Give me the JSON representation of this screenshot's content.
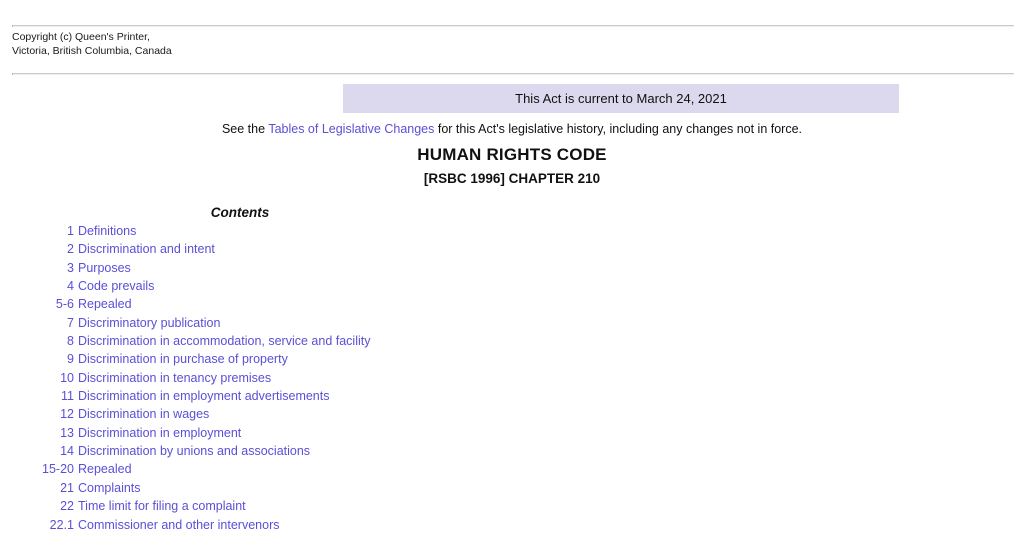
{
  "header": {
    "copyright": "Copyright (c) Queen's Printer,\nVictoria, British Columbia, Canada"
  },
  "banner": {
    "currency_notice": "This Act is current to March 24, 2021",
    "background_color": "#dcd9ee"
  },
  "legislative_changes": {
    "prefix": "See the ",
    "link_text": "Tables of Legislative Changes",
    "suffix": " for this Act's legislative history, including any changes not in force."
  },
  "act": {
    "title": "HUMAN RIGHTS CODE",
    "chapter": "[RSBC 1996] CHAPTER 210"
  },
  "contents": {
    "heading": "Contents",
    "link_color": "#5b4fd6",
    "items": [
      {
        "num": "1",
        "label": "Definitions"
      },
      {
        "num": "2",
        "label": "Discrimination and intent"
      },
      {
        "num": "3",
        "label": "Purposes"
      },
      {
        "num": "4",
        "label": "Code prevails"
      },
      {
        "num": "5-6",
        "label": "Repealed"
      },
      {
        "num": "7",
        "label": "Discriminatory publication"
      },
      {
        "num": "8",
        "label": "Discrimination in accommodation, service and facility"
      },
      {
        "num": "9",
        "label": "Discrimination in purchase of property"
      },
      {
        "num": "10",
        "label": "Discrimination in tenancy premises"
      },
      {
        "num": "11",
        "label": "Discrimination in employment advertisements"
      },
      {
        "num": "12",
        "label": "Discrimination in wages"
      },
      {
        "num": "13",
        "label": "Discrimination in employment"
      },
      {
        "num": "14",
        "label": "Discrimination by unions and associations"
      },
      {
        "num": "15-20",
        "label": "Repealed"
      },
      {
        "num": "21",
        "label": "Complaints"
      },
      {
        "num": "22",
        "label": "Time limit for filing a complaint"
      },
      {
        "num": "22.1",
        "label": "Commissioner and other intervenors"
      }
    ]
  }
}
